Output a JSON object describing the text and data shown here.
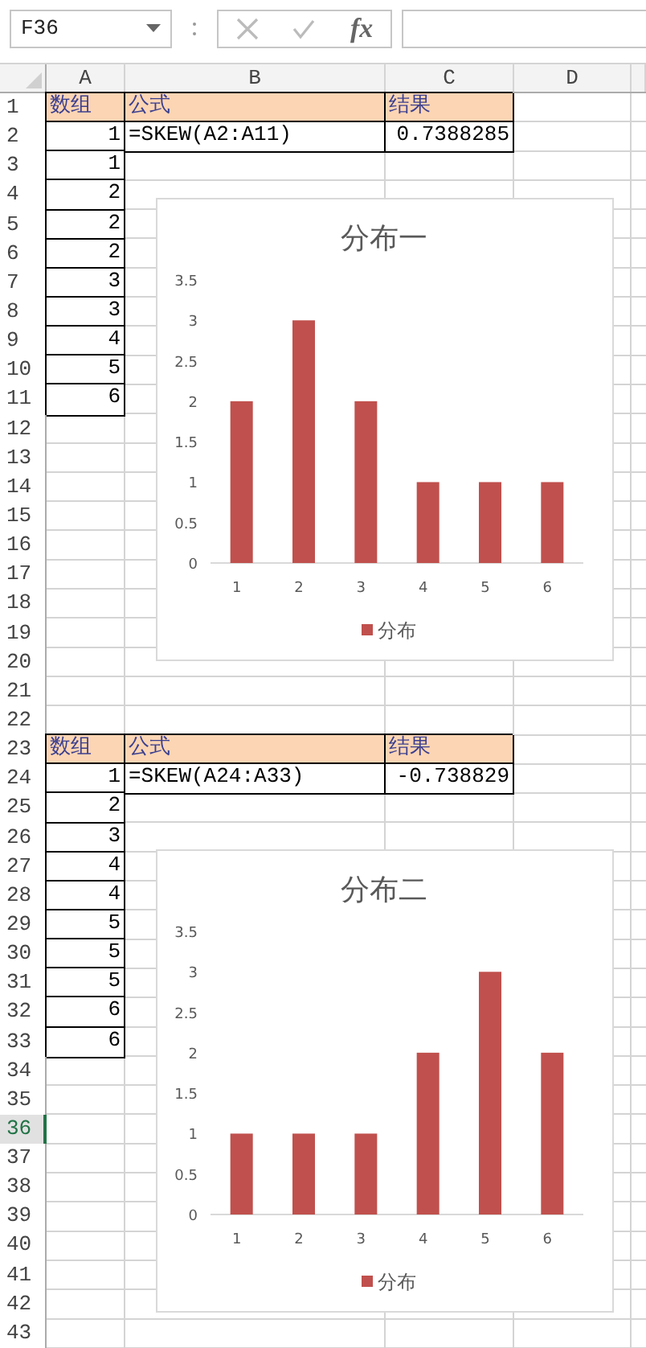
{
  "name_box": {
    "value": "F36"
  },
  "formula_bar": {
    "function_label": "fx"
  },
  "columns": [
    "A",
    "B",
    "C",
    "D"
  ],
  "rows": [
    {
      "label": "1",
      "selected": false,
      "A": {
        "kind": "header",
        "text": "数组"
      },
      "B": {
        "kind": "header",
        "text": "公式"
      },
      "C": {
        "kind": "header",
        "text": "结果"
      }
    },
    {
      "label": "2",
      "selected": false,
      "A": {
        "kind": "number",
        "text": "1"
      },
      "B": {
        "kind": "text",
        "text": "=SKEW(A2:A11)"
      },
      "C": {
        "kind": "number",
        "text": "0.7388285"
      }
    },
    {
      "label": "3",
      "selected": false,
      "A": {
        "kind": "number",
        "text": "1"
      }
    },
    {
      "label": "4",
      "selected": false,
      "A": {
        "kind": "number",
        "text": "2"
      }
    },
    {
      "label": "5",
      "selected": false,
      "A": {
        "kind": "number",
        "text": "2"
      }
    },
    {
      "label": "6",
      "selected": false,
      "A": {
        "kind": "number",
        "text": "2"
      }
    },
    {
      "label": "7",
      "selected": false,
      "A": {
        "kind": "number",
        "text": "3"
      }
    },
    {
      "label": "8",
      "selected": false,
      "A": {
        "kind": "number",
        "text": "3"
      }
    },
    {
      "label": "9",
      "selected": false,
      "A": {
        "kind": "number",
        "text": "4"
      }
    },
    {
      "label": "10",
      "selected": false,
      "A": {
        "kind": "number",
        "text": "5"
      }
    },
    {
      "label": "11",
      "selected": false,
      "A": {
        "kind": "number",
        "text": "6"
      }
    },
    {
      "label": "12",
      "selected": false
    },
    {
      "label": "13",
      "selected": false
    },
    {
      "label": "14",
      "selected": false
    },
    {
      "label": "15",
      "selected": false
    },
    {
      "label": "16",
      "selected": false
    },
    {
      "label": "17",
      "selected": false
    },
    {
      "label": "18",
      "selected": false
    },
    {
      "label": "19",
      "selected": false
    },
    {
      "label": "20",
      "selected": false
    },
    {
      "label": "21",
      "selected": false
    },
    {
      "label": "22",
      "selected": false
    },
    {
      "label": "23",
      "selected": false,
      "A": {
        "kind": "header",
        "text": "数组"
      },
      "B": {
        "kind": "header",
        "text": "公式"
      },
      "C": {
        "kind": "header",
        "text": "结果"
      }
    },
    {
      "label": "24",
      "selected": false,
      "A": {
        "kind": "number",
        "text": "1"
      },
      "B": {
        "kind": "text",
        "text": "=SKEW(A24:A33)"
      },
      "C": {
        "kind": "number",
        "text": "-0.738829"
      }
    },
    {
      "label": "25",
      "selected": false,
      "A": {
        "kind": "number",
        "text": "2"
      }
    },
    {
      "label": "26",
      "selected": false,
      "A": {
        "kind": "number",
        "text": "3"
      }
    },
    {
      "label": "27",
      "selected": false,
      "A": {
        "kind": "number",
        "text": "4"
      }
    },
    {
      "label": "28",
      "selected": false,
      "A": {
        "kind": "number",
        "text": "4"
      }
    },
    {
      "label": "29",
      "selected": false,
      "A": {
        "kind": "number",
        "text": "5"
      }
    },
    {
      "label": "30",
      "selected": false,
      "A": {
        "kind": "number",
        "text": "5"
      }
    },
    {
      "label": "31",
      "selected": false,
      "A": {
        "kind": "number",
        "text": "5"
      }
    },
    {
      "label": "32",
      "selected": false,
      "A": {
        "kind": "number",
        "text": "6"
      }
    },
    {
      "label": "33",
      "selected": false,
      "A": {
        "kind": "number",
        "text": "6"
      }
    },
    {
      "label": "34",
      "selected": false
    },
    {
      "label": "35",
      "selected": false
    },
    {
      "label": "36",
      "selected": true
    },
    {
      "label": "37",
      "selected": false
    },
    {
      "label": "38",
      "selected": false
    },
    {
      "label": "39",
      "selected": false
    },
    {
      "label": "40",
      "selected": false
    },
    {
      "label": "41",
      "selected": false
    },
    {
      "label": "42",
      "selected": false
    },
    {
      "label": "43",
      "selected": false
    }
  ],
  "charts": [
    {
      "chart_data": {
        "type": "bar",
        "title": "分布一",
        "categories": [
          "1",
          "2",
          "3",
          "4",
          "5",
          "6"
        ],
        "ylim": [
          0,
          3.5
        ],
        "yticks": [
          0,
          0.5,
          1,
          1.5,
          2,
          2.5,
          3,
          3.5
        ],
        "series": [
          {
            "name": "分布",
            "color": "#c0504d",
            "values": [
              2,
              3,
              2,
              1,
              1,
              1
            ]
          }
        ]
      }
    },
    {
      "chart_data": {
        "type": "bar",
        "title": "分布二",
        "categories": [
          "1",
          "2",
          "3",
          "4",
          "5",
          "6"
        ],
        "ylim": [
          0,
          3.5
        ],
        "yticks": [
          0,
          0.5,
          1,
          1.5,
          2,
          2.5,
          3,
          3.5
        ],
        "series": [
          {
            "name": "分布",
            "color": "#c0504d",
            "values": [
              1,
              1,
              1,
              2,
              3,
              2
            ]
          }
        ]
      }
    }
  ]
}
